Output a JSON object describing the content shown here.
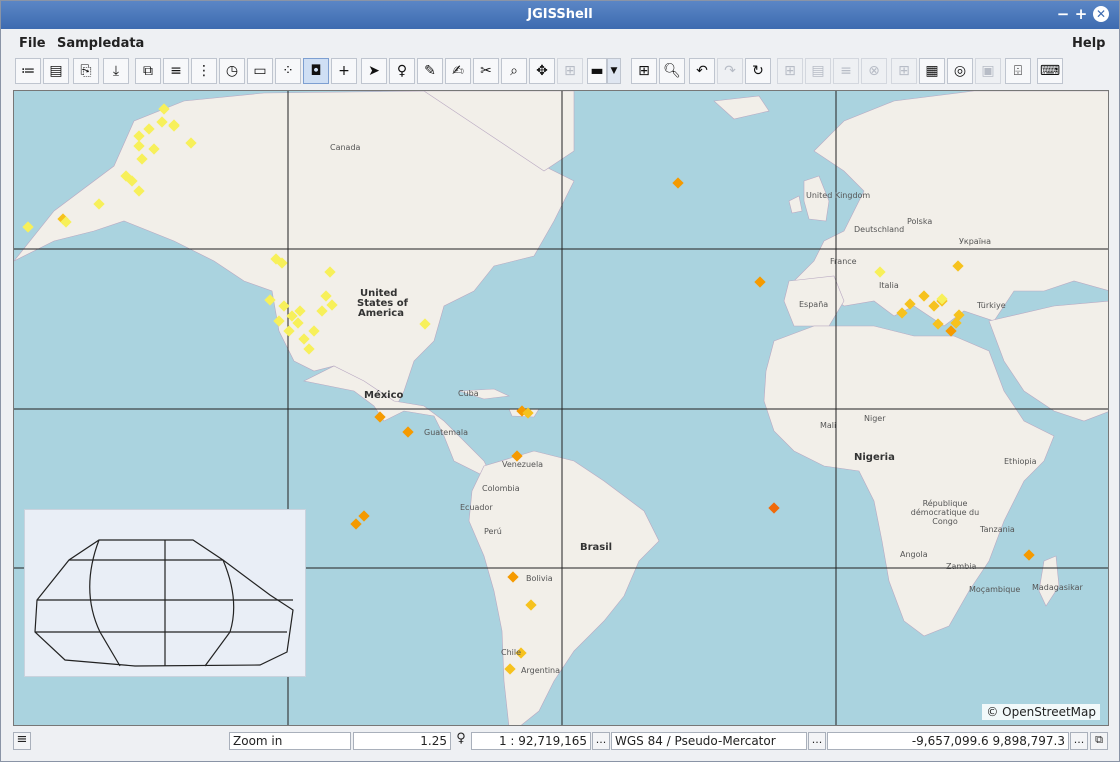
{
  "window": {
    "title": "JGISShell",
    "minimize": "−",
    "maximize": "+",
    "close": "✕"
  },
  "menu": {
    "file": "File",
    "sampledata": "Sampledata",
    "help": "Help"
  },
  "status": {
    "tool": "Zoom in",
    "zoom_value": "1.25",
    "scale": "1 : 92,719,165",
    "crs": "WGS 84 / Pseudo-Mercator",
    "coords": "-9,657,099.6 9,898,797.3",
    "more": "..."
  },
  "map": {
    "attribution": "© OpenStreetMap",
    "labels": {
      "canada": "Canada",
      "usa_line1": "United",
      "usa_line2": "States of",
      "usa_line3": "America",
      "mexico": "México",
      "brasil": "Brasil",
      "nigeria": "Nigeria",
      "turkiye": "Türkiye",
      "italia": "Italia",
      "espana": "España",
      "deutschland": "Deutschland",
      "france": "France",
      "uk": "United Kingdom",
      "argentina": "Argentina",
      "bolivia": "Bolivia",
      "peru": "Perú",
      "colombia": "Colombia",
      "venezuela": "Venezuela",
      "angola": "Angola",
      "zambia": "Zambia",
      "congo": "République démocratique du Congo",
      "ethiopia": "Ethiopia",
      "madagascar": "Madagasikar",
      "polska": "Polska",
      "ukraine": "Україна",
      "cuba": "Cuba",
      "chile": "Chile",
      "niger": "Niger",
      "mali": "Mali",
      "tanzania": "Tanzania",
      "mozambique": "Moçambique",
      "ecuador": "Ecuador",
      "guatemala": "Guatemala"
    }
  },
  "colors": {
    "ocean": "#aad3df",
    "land": "#f2efe9",
    "quake_light": "#f7f05a",
    "quake_mid": "#f6c21e",
    "quake_strong": "#f59a00",
    "quake_max": "#f06a0a"
  }
}
